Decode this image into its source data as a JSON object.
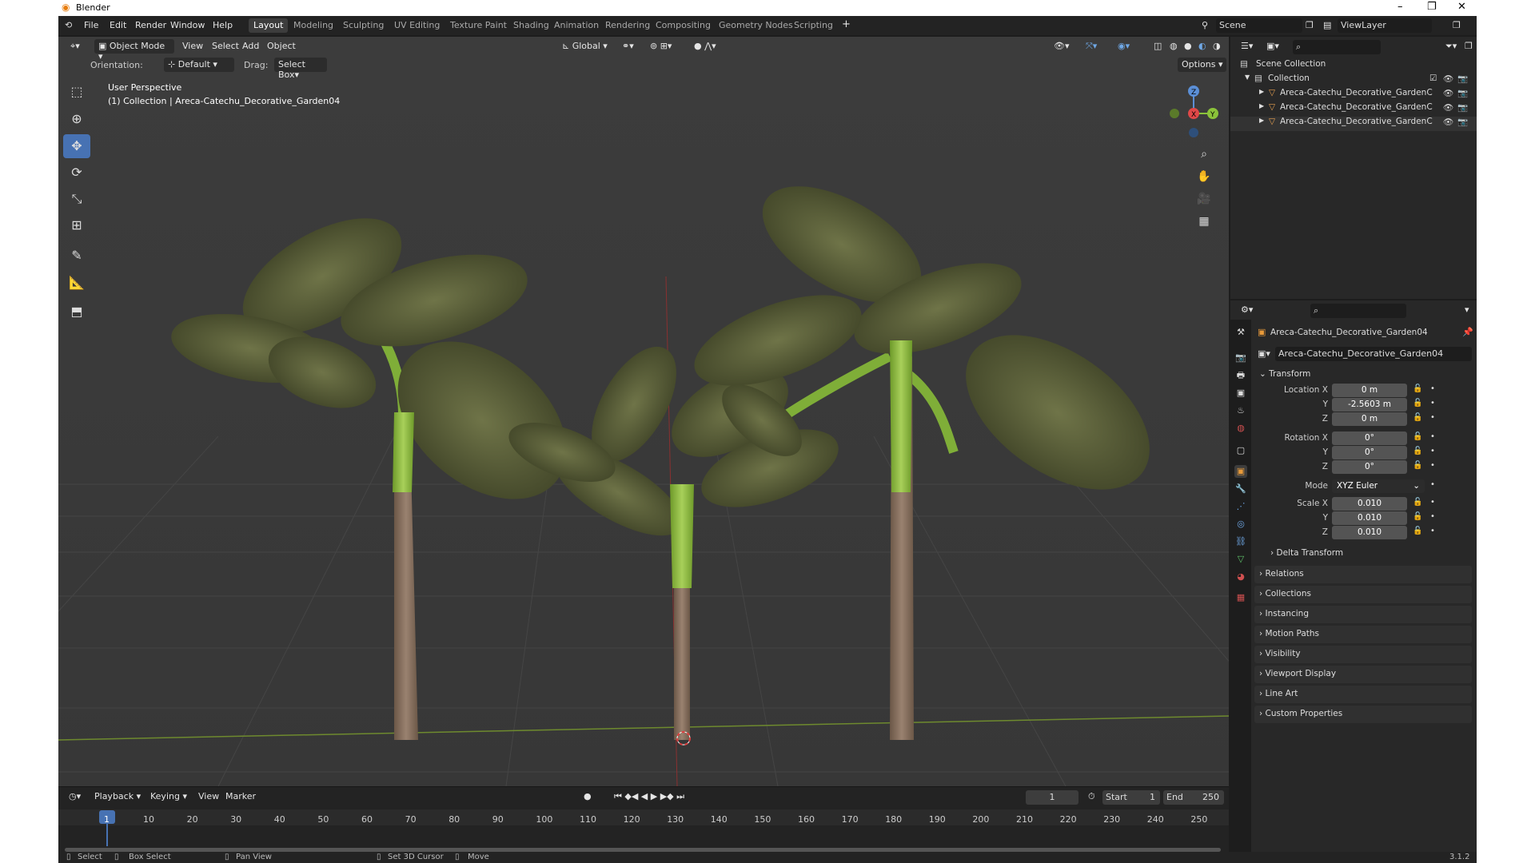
{
  "app": {
    "title": "Blender",
    "version": "3.1.2"
  },
  "menu": [
    "File",
    "Edit",
    "Render",
    "Window",
    "Help"
  ],
  "workspaces": [
    "Layout",
    "Modeling",
    "Sculpting",
    "UV Editing",
    "Texture Paint",
    "Shading",
    "Animation",
    "Rendering",
    "Compositing",
    "Geometry Nodes",
    "Scripting"
  ],
  "scene_name": "Scene",
  "view_layer": "ViewLayer",
  "viewport": {
    "mode": "Object Mode",
    "view": "View",
    "select": "Select",
    "add": "Add",
    "object": "Object",
    "transform_space": "Global",
    "orientation_label": "Orientation:",
    "orientation_value": "Default",
    "drag_label": "Drag:",
    "drag_value": "Select Box",
    "options": "Options",
    "overlay_line1": "User Perspective",
    "overlay_line2": "(1) Collection | Areca-Catechu_Decorative_Garden04",
    "gizmo": {
      "z": "Z",
      "x": "X",
      "y": "Y"
    }
  },
  "outliner": {
    "root": "Scene Collection",
    "collection": "Collection",
    "items": [
      "Areca-Catechu_Decorative_GardenC",
      "Areca-Catechu_Decorative_GardenC",
      "Areca-Catechu_Decorative_GardenC"
    ]
  },
  "properties": {
    "object_name": "Areca-Catechu_Decorative_Garden04",
    "datablock": "Areca-Catechu_Decorative_Garden04",
    "transform_header": "Transform",
    "location": {
      "label": "Location X",
      "x": "0 m",
      "y": "-2.5603 m",
      "z": "0 m"
    },
    "rotation": {
      "label": "Rotation X",
      "x": "0°",
      "y": "0°",
      "z": "0°"
    },
    "mode_label": "Mode",
    "mode_value": "XYZ Euler",
    "scale": {
      "label": "Scale X",
      "x": "0.010",
      "y": "0.010",
      "z": "0.010"
    },
    "axis_y": "Y",
    "axis_z": "Z",
    "delta": "Delta Transform",
    "panels": [
      "Relations",
      "Collections",
      "Instancing",
      "Motion Paths",
      "Visibility",
      "Viewport Display",
      "Line Art",
      "Custom Properties"
    ]
  },
  "timeline": {
    "playback": "Playback",
    "keying": "Keying",
    "view": "View",
    "marker": "Marker",
    "current_frame": "1",
    "start_label": "Start",
    "start": "1",
    "end_label": "End",
    "end": "250",
    "ticks": [
      "1",
      "10",
      "20",
      "30",
      "40",
      "50",
      "60",
      "70",
      "80",
      "90",
      "100",
      "110",
      "120",
      "130",
      "140",
      "150",
      "160",
      "170",
      "180",
      "190",
      "200",
      "210",
      "220",
      "230",
      "240",
      "250"
    ]
  },
  "status": {
    "select": "Select",
    "box_select": "Box Select",
    "pan_view": "Pan View",
    "set_cursor": "Set 3D Cursor",
    "move": "Move"
  }
}
